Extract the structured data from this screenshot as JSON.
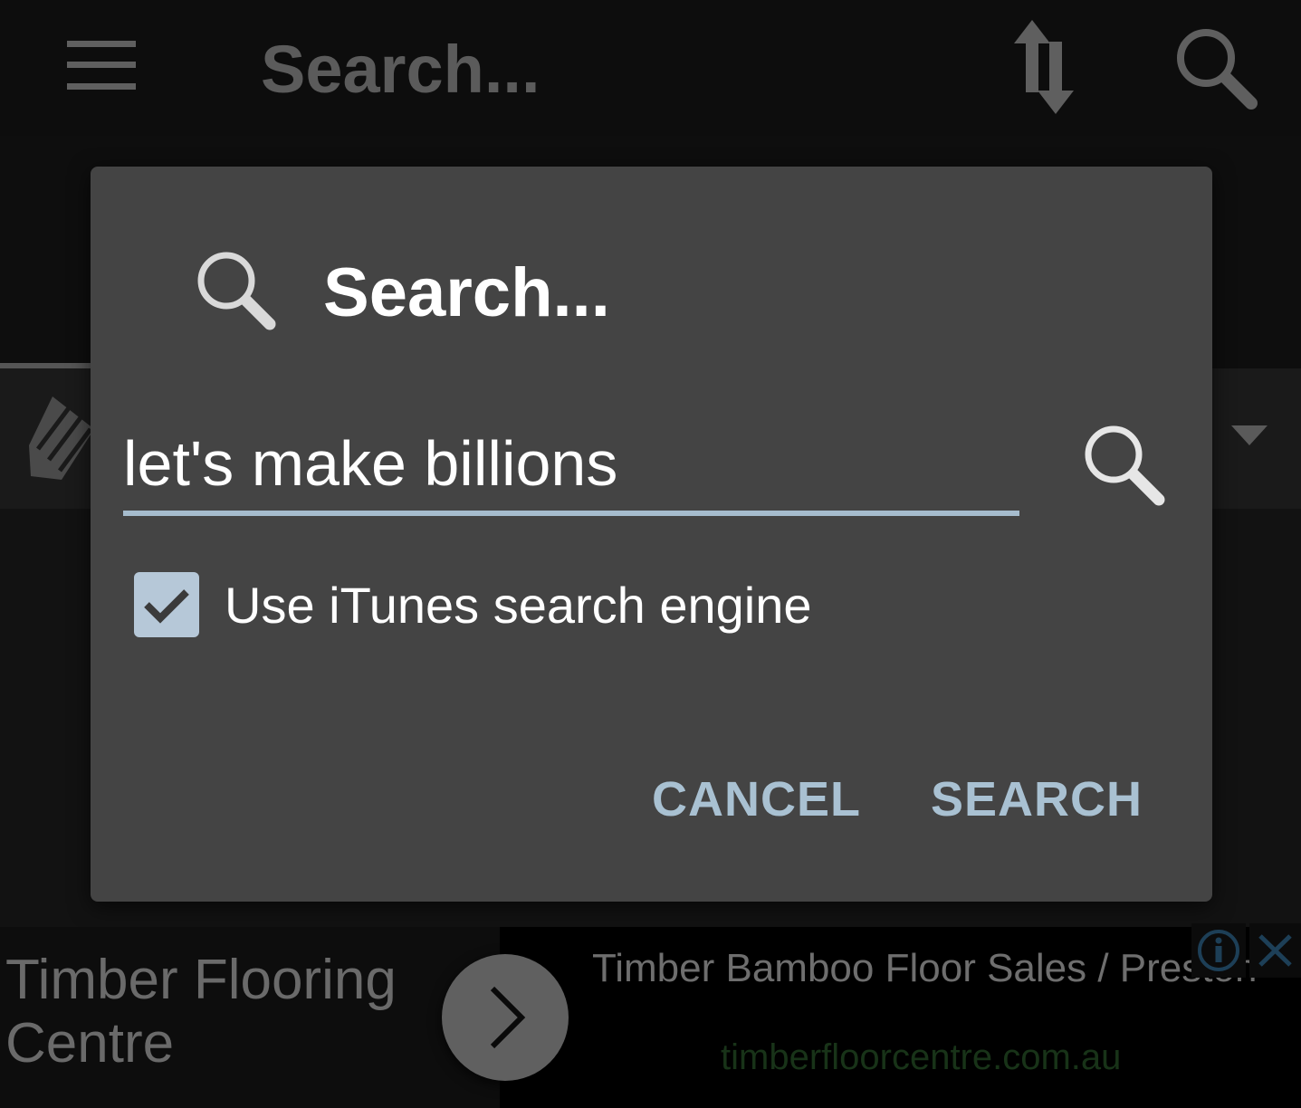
{
  "toolbar": {
    "title": "Search...",
    "icons": {
      "menu": "menu-icon",
      "sort": "sort-arrows-icon",
      "search": "search-icon"
    }
  },
  "dialog": {
    "title": "Search...",
    "title_icon": "search-icon",
    "query": {
      "value": "let's make billions",
      "icon": "search-icon"
    },
    "checkbox": {
      "label": "Use iTunes search engine",
      "checked": true
    },
    "buttons": {
      "cancel": "CANCEL",
      "search": "SEARCH"
    }
  },
  "ad": {
    "brand": "Timber Flooring Centre",
    "headline": "Timber Bamboo Floor Sales / Preston Showroom Wide Range at Lower Cost",
    "url": "timberfloorcentre.com.au",
    "icons": {
      "arrow": "chevron-right-icon",
      "info": "info-icon",
      "close": "close-icon"
    }
  },
  "colors": {
    "dialog_background": "#444444",
    "accent": "#a9c1d2",
    "scrim_background": "#0e0e0e",
    "ad_url": "#183318"
  }
}
